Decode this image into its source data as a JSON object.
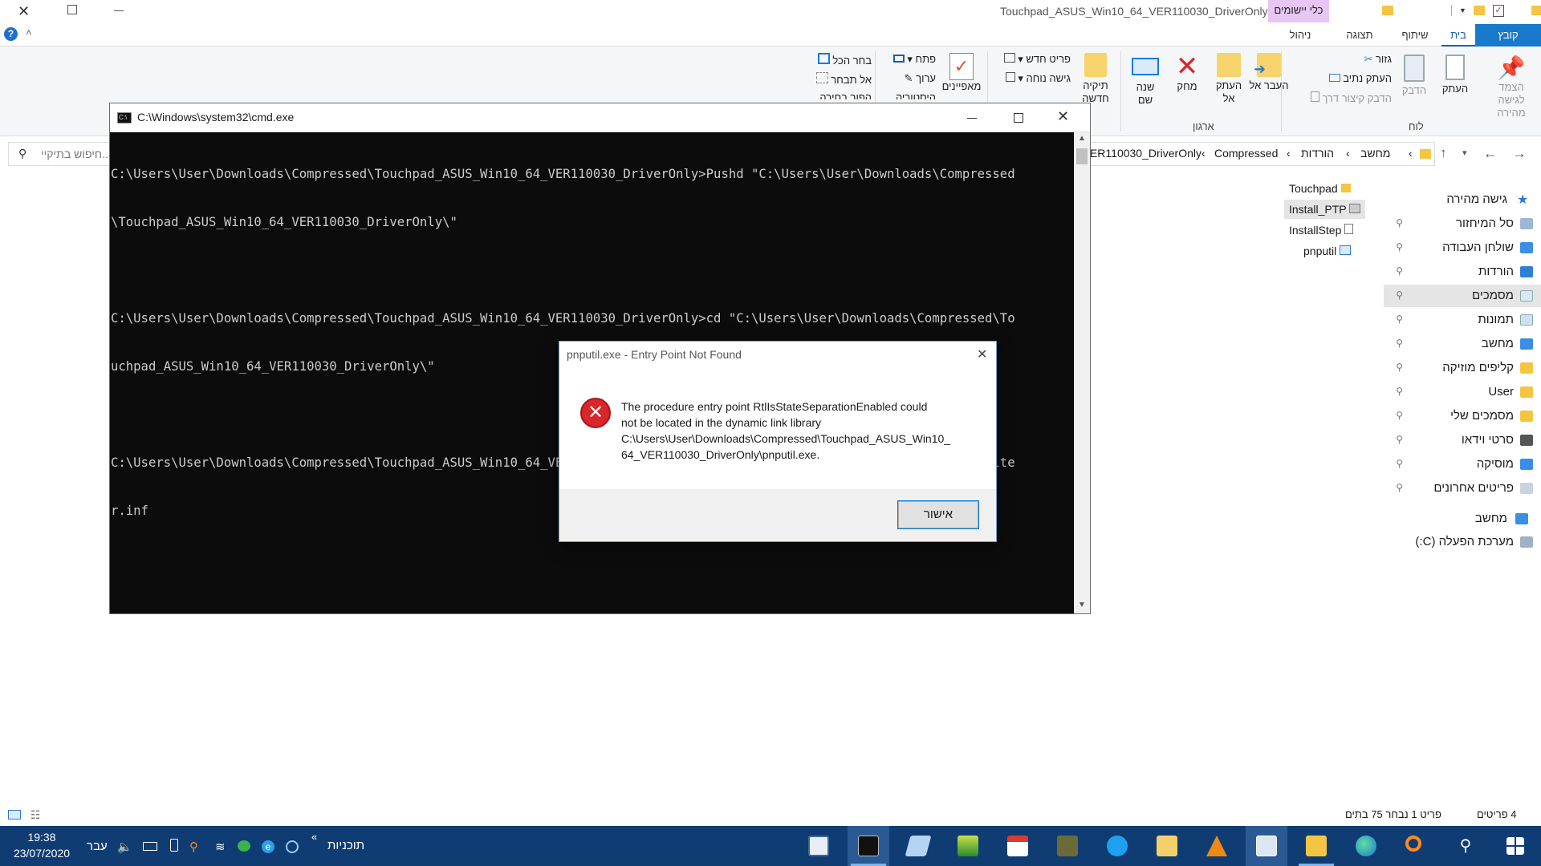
{
  "explorer": {
    "window_title": "Touchpad_ASUS_Win10_64_VER110030_DriverOnly",
    "contextual_tab": "כלי יישומים",
    "tabs": [
      "קובץ",
      "בית",
      "שיתוף",
      "תצוגה",
      "ניהול"
    ],
    "ribbon": {
      "clipboard": {
        "pin": "הצמד לגישה מהירה",
        "copy": "העתק",
        "paste": "הדבק",
        "cut": "גזור",
        "copy_path": "העתק נתיב",
        "paste_shortcut": "הדבק קיצור דרך",
        "group": "לוח"
      },
      "organize": {
        "move_to": "העבר אל",
        "copy_to": "העתק אל",
        "delete": "מחק",
        "rename": "שנה שם",
        "group": "ארגון"
      },
      "new": {
        "new_folder": "תיקיה חדשה",
        "new_item": "פריט חדש",
        "easy_access": "גישה נוחה"
      },
      "open": {
        "properties": "מאפיינים",
        "open": "פתח",
        "edit": "ערוך",
        "history": "היסטוריה"
      },
      "select": {
        "select_all": "בחר הכל",
        "select_none": "אל תבחר",
        "invert": "הפוך בחירה"
      }
    },
    "breadcrumb": [
      "מחשב",
      "הורדות",
      "Compressed",
      "Touchpad_ASUS_Win10_64_VER110030_DriverOnly"
    ],
    "search_placeholder": "...חיפוש בתיקיי",
    "nav": {
      "quick_access": "גישה מהירה",
      "items": [
        "סל המיחזור",
        "שולחן העבודה",
        "הורדות",
        "מסמכים",
        "תמונות",
        "מחשב",
        "קליפים מוזיקה",
        "User",
        "מסמכים שלי",
        "סרטי וידאו",
        "מוסיקה",
        "פריטים אחרונים"
      ],
      "pc": "מחשב",
      "drive": "מערכת הפעלה (C:)"
    },
    "files": [
      "Touchpad",
      "Install_PTP",
      "InstallStep",
      "pnputil"
    ],
    "status": {
      "count": "4 פריטים",
      "selected": "פריט 1 נבחר 75 בתים"
    }
  },
  "cmd": {
    "title": "C:\\Windows\\system32\\cmd.exe",
    "lines": [
      "C:\\Users\\User\\Downloads\\Compressed\\Touchpad_ASUS_Win10_64_VER110030_DriverOnly>Pushd \"C:\\Users\\User\\Downloads\\Compressed",
      "\\Touchpad_ASUS_Win10_64_VER110030_DriverOnly\\\"",
      "",
      "C:\\Users\\User\\Downloads\\Compressed\\Touchpad_ASUS_Win10_64_VER110030_DriverOnly>cd \"C:\\Users\\User\\Downloads\\Compressed\\To",
      "uchpad_ASUS_Win10_64_VER110030_DriverOnly\\\"",
      "",
      "C:\\Users\\User\\Downloads\\Compressed\\Touchpad_ASUS_Win10_64_VER110030_DriverOnly>pnputil -i -a .\\Touchpad\\x64\\AsusPTPFilte",
      "r.inf"
    ]
  },
  "dialog": {
    "title": "pnputil.exe - Entry Point Not Found",
    "message_lines": [
      "The procedure entry point RtlIsStateSeparationEnabled could",
      "not be located in the dynamic link library",
      "C:\\Users\\User\\Downloads\\Compressed\\Touchpad_ASUS_Win10_",
      "64_VER110030_DriverOnly\\pnputil.exe."
    ],
    "ok_label": "אישור"
  },
  "taskbar": {
    "time": "19:38",
    "date": "23/07/2020",
    "lang": "עבר",
    "programs": "תוכניות"
  },
  "colors": {
    "accent": "#0078d7",
    "taskbar": "#0f3c73",
    "contextual": "#e8c6f3",
    "error_red": "#d9262b"
  }
}
